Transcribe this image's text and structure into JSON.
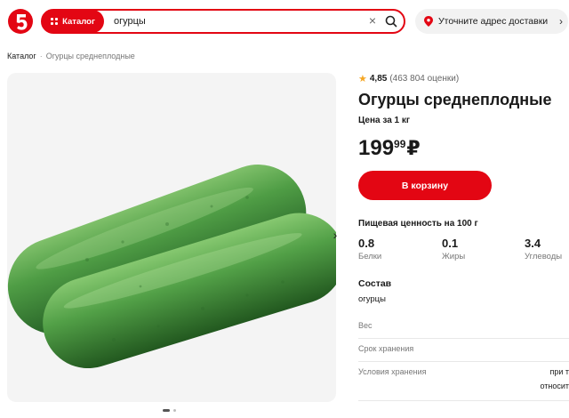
{
  "header": {
    "logo_text": "5",
    "catalog_label": "Каталог",
    "search_value": "огурцы",
    "address_label": "Уточните адрес доставки"
  },
  "breadcrumb": {
    "root": "Каталог",
    "current": "Огурцы среднеплодные"
  },
  "product": {
    "rating": "4,85",
    "rating_count": "(463 804 оценки)",
    "title": "Огурцы среднеплодные",
    "unit": "Цена за 1 кг",
    "price_rub": "199",
    "price_kop": "99",
    "currency": "₽",
    "cart_label": "В корзину"
  },
  "nutrition": {
    "title": "Пищевая ценность на 100 г",
    "items": [
      {
        "value": "0.8",
        "label": "Белки"
      },
      {
        "value": "0.1",
        "label": "Жиры"
      },
      {
        "value": "3.4",
        "label": "Углеводы"
      }
    ]
  },
  "composition": {
    "title": "Состав",
    "value": "огурцы"
  },
  "attributes": [
    {
      "label": "Вес",
      "value": ""
    },
    {
      "label": "Срок хранения",
      "value": ""
    },
    {
      "label": "Условия хранения",
      "value": "при т",
      "value2": "относит"
    }
  ],
  "gallery": {
    "slides": 2,
    "active": 1
  },
  "colors": {
    "brand_red": "#e30613",
    "star": "#f5a623"
  }
}
